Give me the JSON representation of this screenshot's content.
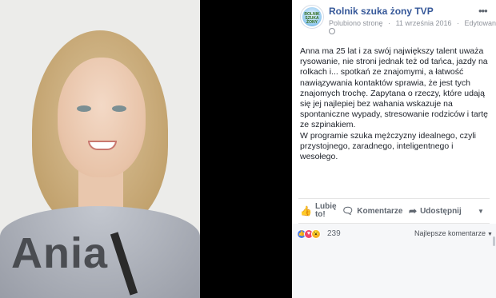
{
  "photo": {
    "overlay_name": "Ania"
  },
  "post": {
    "page_name": "Rolnik szuka żony TVP",
    "avatar_text": "ROLNIK SZUKA ŻONY",
    "meta": {
      "liked": "Polubiono stronę",
      "separator1": "·",
      "date": "11 września 2016",
      "separator2": "·",
      "edited": "Edytowany"
    },
    "more_label": "•••",
    "text_paragraph1": "Anna ma 25 lat i za swój największy talent uważa rysowanie, nie stroni jednak też od tańca, jazdy na rolkach i... spotkań ze znajomymi, a łatwość nawiązywania kontaktów sprawia, że jest tych znajomych trochę. Zapytana o rzeczy, które udają się jej najlepiej bez wahania wskazuje na spontaniczne wypady, stresowanie rodziców i tartę ze szpinakiem.",
    "text_paragraph2": "W programie szuka mężczyzny idealnego, czyli przystojnego, zaradnego, inteligentnego i wesołego."
  },
  "actions": {
    "like_line1": "Lubię",
    "like_line2": "to!",
    "comment": "Komentarze",
    "share": "Udostępnij",
    "caret": "▼"
  },
  "stats": {
    "reaction_count": "239",
    "sort_label": "Najlepsze komentarze",
    "sort_caret": "▼"
  },
  "icons": {
    "like": "thumbs-up-icon",
    "comment": "speech-bubble-icon",
    "share": "share-arrow-icon",
    "globe": "globe-icon"
  },
  "colors": {
    "page_name": "#365899",
    "like_reaction": "#4b7bec",
    "love_reaction": "#f0476a",
    "wow_reaction": "#f7b125"
  }
}
